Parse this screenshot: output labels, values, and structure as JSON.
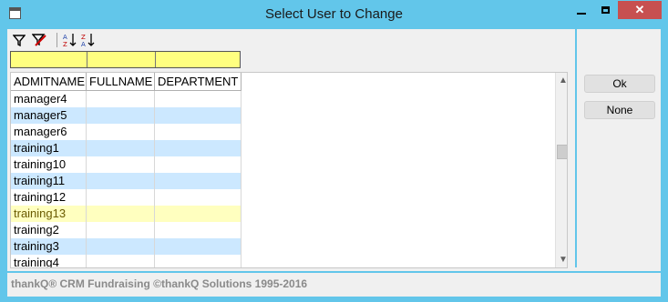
{
  "window": {
    "title": "Select User to Change",
    "controls": {
      "minimize": "minimize-icon",
      "maximize": "maximize-icon",
      "close": "✕"
    }
  },
  "toolbar": {
    "icons": [
      "filter-icon",
      "clear-filter-icon",
      "sort-ascending-icon",
      "sort-descending-icon"
    ]
  },
  "grid": {
    "columns": [
      "ADMITNAME",
      "FULLNAME",
      "DEPARTMENT"
    ],
    "rows": [
      {
        "admitname": "manager4",
        "fullname": "",
        "department": ""
      },
      {
        "admitname": "manager5",
        "fullname": "",
        "department": ""
      },
      {
        "admitname": "manager6",
        "fullname": "",
        "department": ""
      },
      {
        "admitname": "training1",
        "fullname": "",
        "department": ""
      },
      {
        "admitname": "training10",
        "fullname": "",
        "department": ""
      },
      {
        "admitname": "training11",
        "fullname": "",
        "department": ""
      },
      {
        "admitname": "training12",
        "fullname": "",
        "department": ""
      },
      {
        "admitname": "training13",
        "fullname": "",
        "department": ""
      },
      {
        "admitname": "training2",
        "fullname": "",
        "department": ""
      },
      {
        "admitname": "training3",
        "fullname": "",
        "department": ""
      },
      {
        "admitname": "training4",
        "fullname": "",
        "department": ""
      }
    ],
    "selected_row": 7,
    "colors": {
      "row_alt": "#cce8ff",
      "row_selected": "#ffffbf",
      "filter_row": "#ffff80"
    }
  },
  "buttons": {
    "ok_label": "Ok",
    "none_label": "None"
  },
  "footer": {
    "text": "thankQ® CRM Fundraising ©thankQ Solutions 1995-2016"
  }
}
